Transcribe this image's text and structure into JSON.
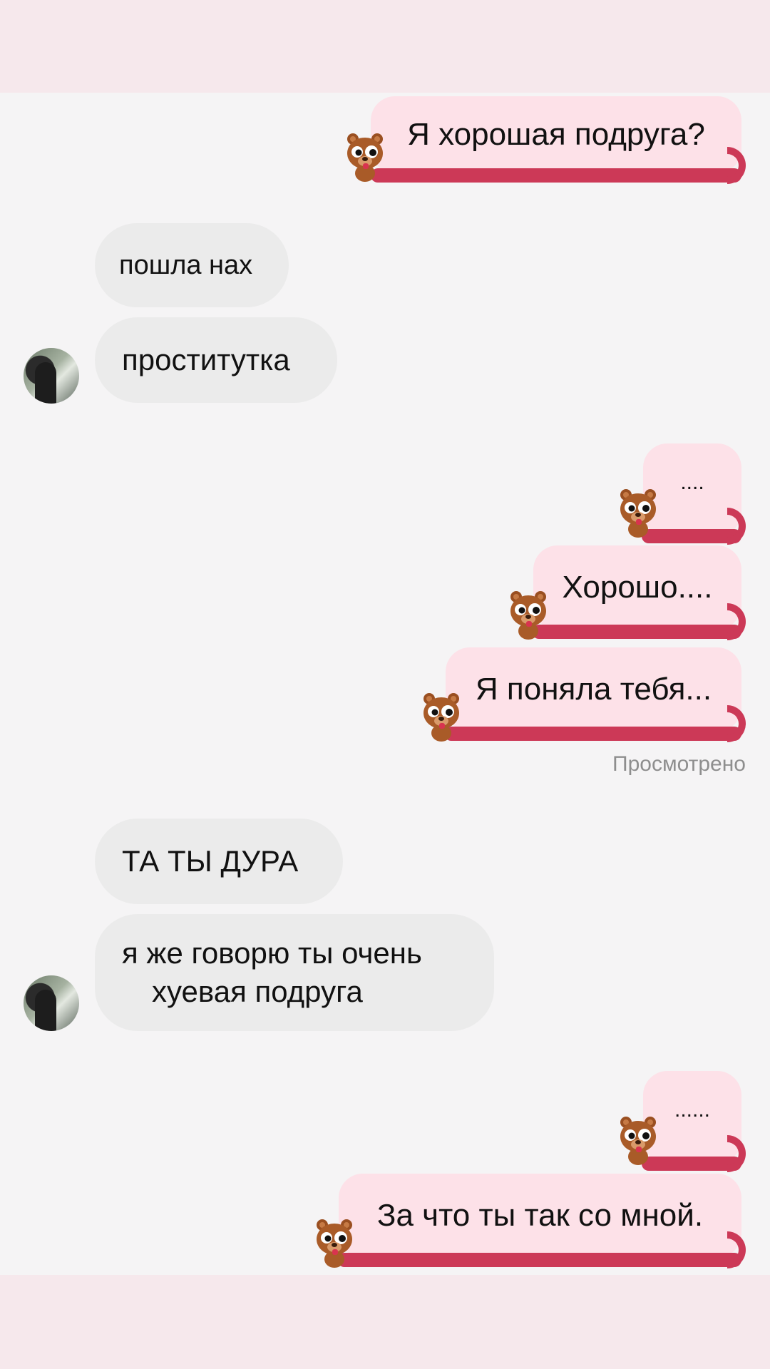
{
  "messages": {
    "m1": "Я хорошая подруга?",
    "m2": "пошла нах",
    "m3": "проститутка",
    "m4": "....",
    "m5": "Хорошо....",
    "m6": "Я поняла тебя...",
    "m7": "ТА ТЫ ДУРА",
    "m8_line1": "я же говорю ты очень",
    "m8_line2": "хуевая  подруга",
    "m9": "......",
    "m10": "За что ты так со мной."
  },
  "status": {
    "seen": "Просмотрено"
  },
  "colors": {
    "sent_bubble": "#fde1e8",
    "received_bubble": "#ebebeb",
    "tail_accent": "#cc3957",
    "background": "#f5f4f5",
    "top_bottom_bars": "#f6e8ec"
  },
  "icons": {
    "sender_sticker": "bear-sticker-icon",
    "contact_avatar": "contact-avatar"
  }
}
